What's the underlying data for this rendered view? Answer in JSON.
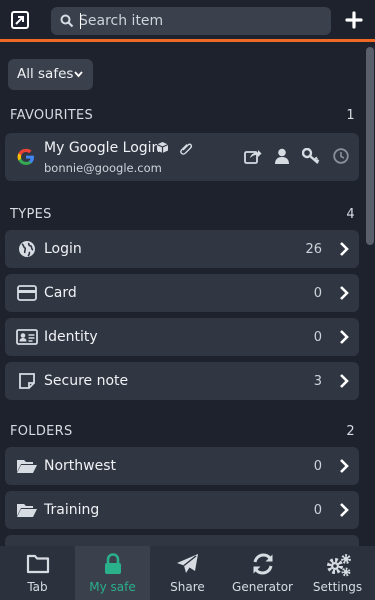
{
  "search": {
    "placeholder": "Search item"
  },
  "safes": {
    "label": "All safes"
  },
  "favourites": {
    "heading": "FAVOURITES",
    "count": "1",
    "items": [
      {
        "title": "My Google Login",
        "subtitle": "bonnie@google.com",
        "icon": "google-logo-icon"
      }
    ]
  },
  "types": {
    "heading": "TYPES",
    "count": "4",
    "items": [
      {
        "label": "Login",
        "count": "26",
        "icon": "globe-icon"
      },
      {
        "label": "Card",
        "count": "0",
        "icon": "credit-card-icon"
      },
      {
        "label": "Identity",
        "count": "0",
        "icon": "id-card-icon"
      },
      {
        "label": "Secure note",
        "count": "3",
        "icon": "note-icon"
      }
    ]
  },
  "folders": {
    "heading": "FOLDERS",
    "count": "2",
    "items": [
      {
        "label": "Northwest",
        "count": "0",
        "icon": "folder-open-icon"
      },
      {
        "label": "Training",
        "count": "0",
        "icon": "folder-open-icon"
      }
    ]
  },
  "tabs": [
    {
      "label": "Tab",
      "icon": "folder-icon"
    },
    {
      "label": "My safe",
      "icon": "lock-icon",
      "active": true
    },
    {
      "label": "Share",
      "icon": "paper-plane-icon"
    },
    {
      "label": "Generator",
      "icon": "refresh-icon"
    },
    {
      "label": "Settings",
      "icon": "gears-icon"
    }
  ],
  "colors": {
    "accent": "#f06a25",
    "active_tab": "#2ab08a",
    "background": "#1d222d",
    "card": "#303642"
  }
}
